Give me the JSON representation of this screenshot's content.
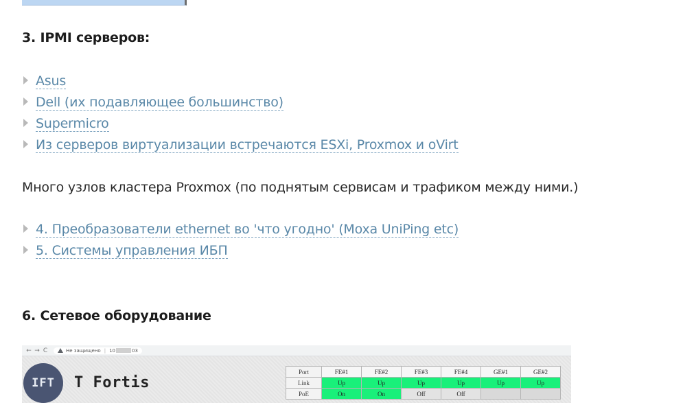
{
  "heading_ipmi": "3. IPMI серверов:",
  "ipmi_spoilers": [
    "Asus",
    "Dell (их подавляющее большинство)",
    "Supermicro",
    "Из серверов виртуализации встречаются ESXi, Proxmox и oVirt"
  ],
  "paragraph": "Много узлов кластера Proxmox (по поднятым сервисам и трафиком между ними.)",
  "more_spoilers": [
    "4. Преобразователи ethernet во 'что угодно' (Moxa UniPing etc)",
    "5. Системы управления ИБП"
  ],
  "heading_network": "6. Сетевое оборудование",
  "screenshot": {
    "browser": {
      "back": "←",
      "forward": "→",
      "reload": "C",
      "not_secure": "Не защищено",
      "separator": "|",
      "ip_prefix": "10",
      "ip_suffix": "03"
    },
    "logo_mark": "IFT",
    "brand": "T Fortis",
    "port_table": {
      "headers": [
        "Port",
        "FE#1",
        "FE#2",
        "FE#3",
        "FE#4",
        "GE#1",
        "GE#2"
      ],
      "link": [
        "Link",
        "Up",
        "Up",
        "Up",
        "Up",
        "Up",
        "Up"
      ],
      "poe": [
        "PoE",
        "On",
        "On",
        "Off",
        "Off",
        "",
        ""
      ]
    }
  },
  "colors": {
    "link": "#5a88a8",
    "status_green": "#19f07a",
    "logo_bg": "#4a5572"
  }
}
